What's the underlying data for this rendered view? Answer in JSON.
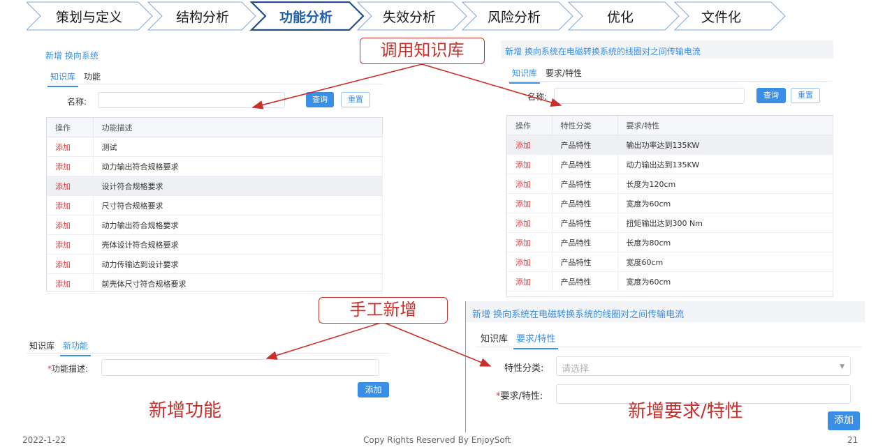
{
  "steps": [
    {
      "label": "策划与定义",
      "active": false
    },
    {
      "label": "结构分析",
      "active": false
    },
    {
      "label": "功能分析",
      "active": true
    },
    {
      "label": "失效分析",
      "active": false
    },
    {
      "label": "风险分析",
      "active": false
    },
    {
      "label": "优化",
      "active": false
    },
    {
      "label": "文件化",
      "active": false
    }
  ],
  "callouts": {
    "knowledge": "调用知识库",
    "manual": "手工新增"
  },
  "captions": {
    "new_function": "新增功能",
    "new_requirement": "新增要求/特性"
  },
  "panel_tl": {
    "title": "新增  换向系统",
    "tabs": [
      "知识库",
      "功能"
    ],
    "name_label": "名称:",
    "query": "查询",
    "reset": "重置",
    "columns": [
      "操作",
      "功能描述"
    ],
    "rows": [
      [
        "添加",
        "测试"
      ],
      [
        "添加",
        "动力输出符合规格要求"
      ],
      [
        "添加",
        "设计符合规格要求"
      ],
      [
        "添加",
        "尺寸符合规格要求"
      ],
      [
        "添加",
        "动力输出符合规格要求"
      ],
      [
        "添加",
        "壳体设计符合规格要求"
      ],
      [
        "添加",
        "动力传输达到设计要求"
      ],
      [
        "添加",
        "前壳体尺寸符合规格要求"
      ]
    ]
  },
  "panel_tr": {
    "title": "新增  换向系统在电磁转换系统的线圈对之间传输电流",
    "tabs": [
      "知识库",
      "要求/特性"
    ],
    "name_label": "名称:",
    "query": "查询",
    "reset": "重置",
    "columns": [
      "操作",
      "特性分类",
      "要求/特性"
    ],
    "rows": [
      [
        "添加",
        "产品特性",
        "输出功率达到135KW"
      ],
      [
        "添加",
        "产品特性",
        "动力输出达到135KW"
      ],
      [
        "添加",
        "产品特性",
        "长度为120cm"
      ],
      [
        "添加",
        "产品特性",
        "宽度为60cm"
      ],
      [
        "添加",
        "产品特性",
        "扭矩输出达到300 Nm"
      ],
      [
        "添加",
        "产品特性",
        "长度为80cm"
      ],
      [
        "添加",
        "产品特性",
        "宽度60cm"
      ],
      [
        "添加",
        "产品特性",
        "宽度为60cm"
      ]
    ]
  },
  "panel_bl": {
    "tabs": [
      "知识库",
      "新功能"
    ],
    "field_label": "功能描述:",
    "add": "添加"
  },
  "panel_br": {
    "title": "新增  换向系统在电磁转换系统的线圈对之间传输电流",
    "tabs": [
      "知识库",
      "要求/特性"
    ],
    "category_label": "特性分类:",
    "category_placeholder": "请选择",
    "requirement_label": "要求/特性:",
    "add": "添加"
  },
  "footer": {
    "date": "2022-1-22",
    "copyright": "Copy Rights Reserved By EnjoySoft",
    "page": "21"
  },
  "colors": {
    "accent": "#3a8ee6",
    "callout": "#c9302c",
    "step_active": "#1f5fa8"
  }
}
